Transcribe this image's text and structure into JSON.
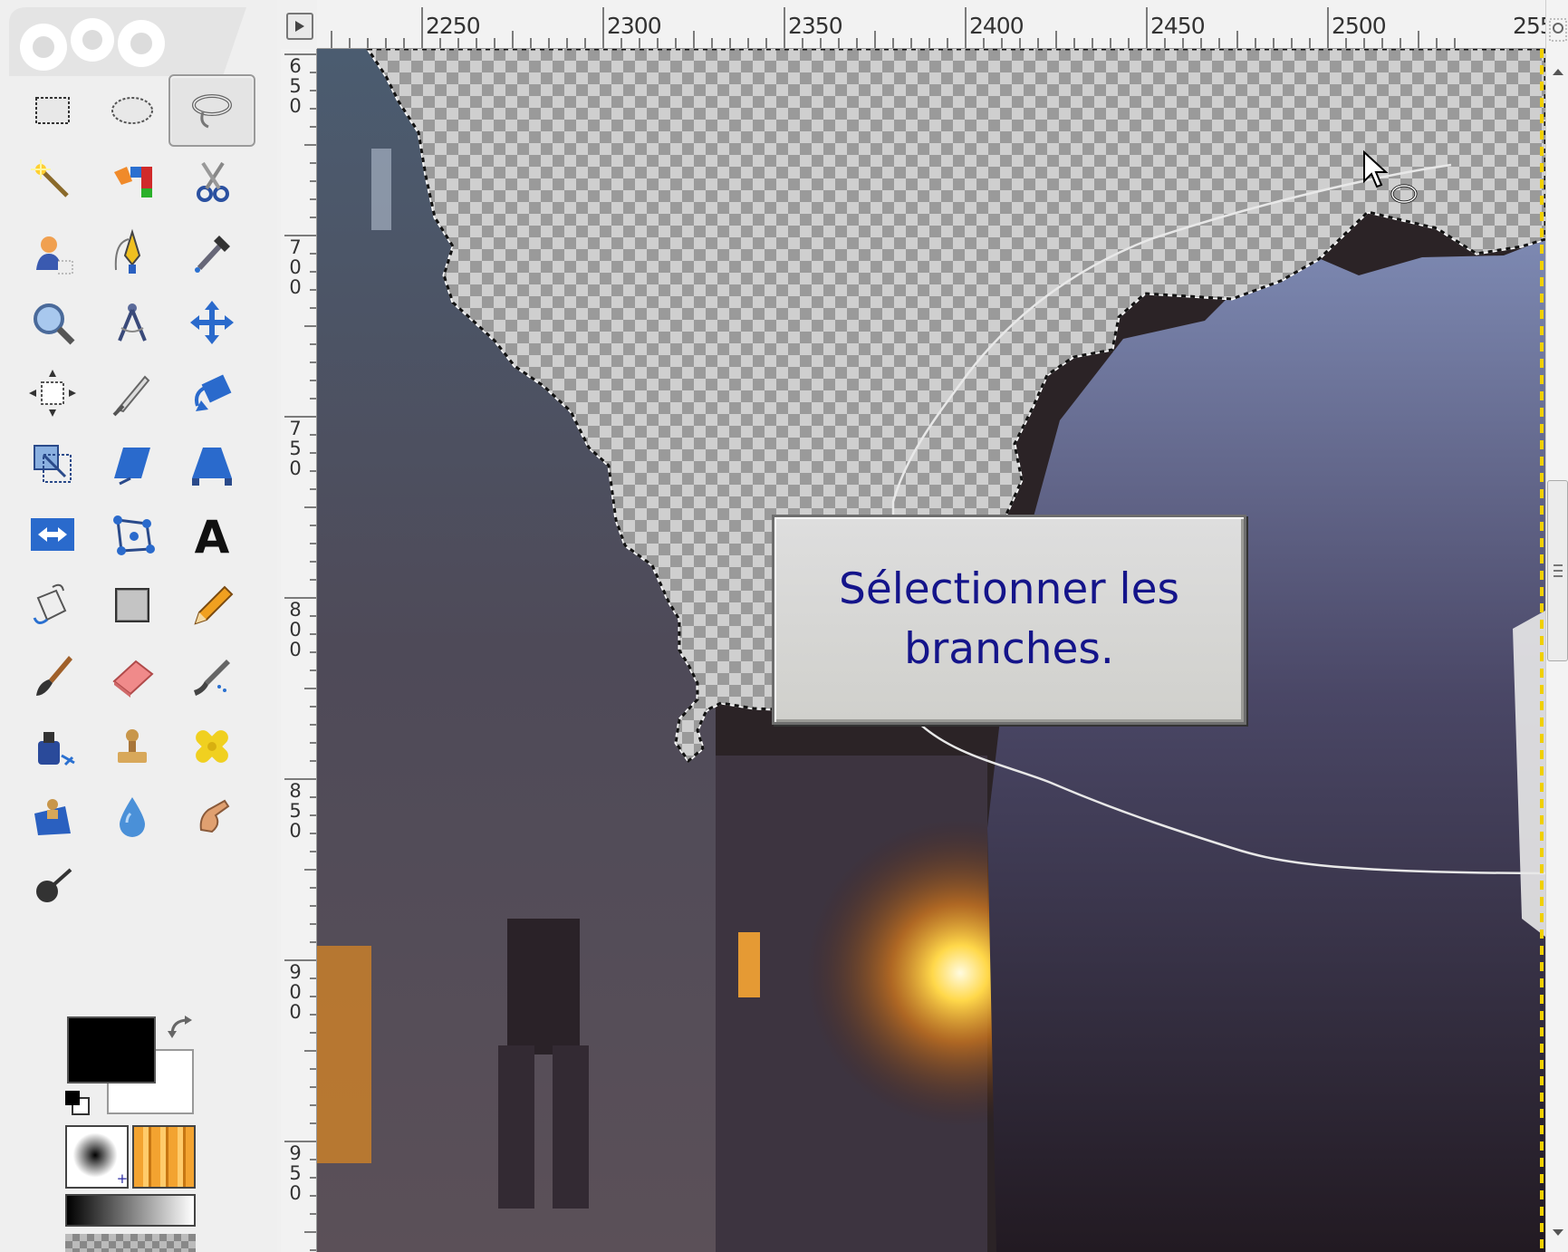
{
  "toolbox": {
    "tools": [
      {
        "name": "rect-select",
        "icon": "rectangle-select-icon",
        "active": false
      },
      {
        "name": "ellipse-select",
        "icon": "ellipse-select-icon",
        "active": false
      },
      {
        "name": "free-select",
        "icon": "lasso-icon",
        "active": true
      },
      {
        "name": "fuzzy-select",
        "icon": "magic-wand-icon",
        "active": false
      },
      {
        "name": "select-by-color",
        "icon": "select-by-color-icon",
        "active": false
      },
      {
        "name": "scissors-select",
        "icon": "scissors-icon",
        "active": false
      },
      {
        "name": "foreground-select",
        "icon": "foreground-select-icon",
        "active": false
      },
      {
        "name": "paths",
        "icon": "paths-pen-icon",
        "active": false
      },
      {
        "name": "color-picker",
        "icon": "eyedropper-icon",
        "active": false
      },
      {
        "name": "zoom",
        "icon": "magnifier-icon",
        "active": false
      },
      {
        "name": "measure",
        "icon": "compass-icon",
        "active": false
      },
      {
        "name": "move",
        "icon": "move-arrows-icon",
        "active": false
      },
      {
        "name": "align",
        "icon": "align-icon",
        "active": false
      },
      {
        "name": "crop",
        "icon": "crop-knife-icon",
        "active": false
      },
      {
        "name": "rotate",
        "icon": "rotate-icon",
        "active": false
      },
      {
        "name": "scale",
        "icon": "scale-icon",
        "active": false
      },
      {
        "name": "shear",
        "icon": "shear-icon",
        "active": false
      },
      {
        "name": "perspective",
        "icon": "perspective-icon",
        "active": false
      },
      {
        "name": "flip",
        "icon": "flip-icon",
        "active": false
      },
      {
        "name": "cage-transform",
        "icon": "cage-icon",
        "active": false
      },
      {
        "name": "text",
        "icon": "text-a-icon",
        "active": false
      },
      {
        "name": "bucket-fill",
        "icon": "bucket-icon",
        "active": false
      },
      {
        "name": "blend",
        "icon": "gradient-icon",
        "active": false
      },
      {
        "name": "pencil",
        "icon": "pencil-icon",
        "active": false
      },
      {
        "name": "paintbrush",
        "icon": "paintbrush-icon",
        "active": false
      },
      {
        "name": "eraser",
        "icon": "eraser-icon",
        "active": false
      },
      {
        "name": "airbrush",
        "icon": "airbrush-icon",
        "active": false
      },
      {
        "name": "ink",
        "icon": "ink-icon",
        "active": false
      },
      {
        "name": "clone",
        "icon": "clone-stamp-icon",
        "active": false
      },
      {
        "name": "heal",
        "icon": "heal-bandage-icon",
        "active": false
      },
      {
        "name": "perspective-clone",
        "icon": "perspective-clone-icon",
        "active": false
      },
      {
        "name": "blur-sharpen",
        "icon": "water-drop-icon",
        "active": false
      },
      {
        "name": "smudge",
        "icon": "smudge-finger-icon",
        "active": false
      },
      {
        "name": "dodge-burn",
        "icon": "dodge-burn-icon",
        "active": false
      }
    ],
    "foreground_color": "#000000",
    "background_color": "#ffffff"
  },
  "rulers": {
    "horizontal": [
      "2250",
      "2300",
      "2350",
      "2400",
      "2450",
      "2500",
      "255"
    ],
    "vertical": [
      "650",
      "700",
      "750",
      "800",
      "850",
      "900",
      "950"
    ]
  },
  "canvas": {
    "tooltip_text": "Sélectionner les branches."
  },
  "colors": {
    "accent": "#14148a",
    "selection": "#ffffff",
    "checker_dark": "#999999",
    "checker_light": "#cccccc"
  }
}
